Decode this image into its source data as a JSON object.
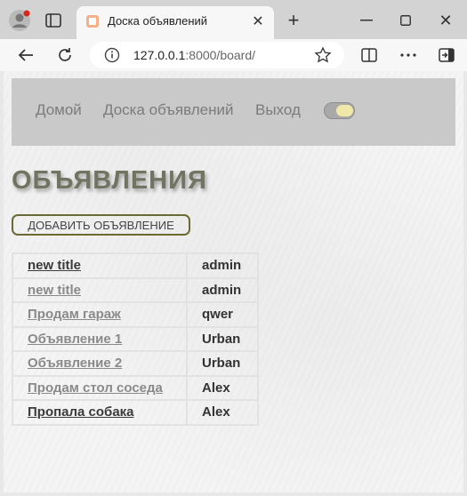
{
  "browser": {
    "tab_title": "Доска объявлений",
    "url_host": "127.0.0.1",
    "url_rest": ":8000/board/"
  },
  "navbar": {
    "home": "Домой",
    "board": "Доска объявлений",
    "exit": "Выход"
  },
  "page": {
    "title": "ОБЪЯВЛЕНИЯ",
    "add_button": "ДОБАВИТЬ ОБЪЯВЛЕНИЕ"
  },
  "ads": [
    {
      "title": "new title",
      "author": "admin"
    },
    {
      "title": "new title",
      "author": "admin"
    },
    {
      "title": "Продам гараж",
      "author": "qwer"
    },
    {
      "title": "Объявление 1",
      "author": "Urban"
    },
    {
      "title": "Объявление 2",
      "author": "Urban"
    },
    {
      "title": "Продам стол соседа",
      "author": "Alex"
    },
    {
      "title": "Пропала собака",
      "author": "Alex"
    }
  ],
  "colors": {
    "title": "#707460",
    "button_border": "#6b6a35",
    "navbar_bg": "#c9c9c9"
  },
  "icons": [
    "profile-icon",
    "tab-actions-icon",
    "favicon-icon",
    "close-tab-icon",
    "new-tab-icon",
    "minimize-icon",
    "maximize-icon",
    "close-window-icon",
    "back-icon",
    "reload-icon",
    "site-info-icon",
    "favorite-star-icon",
    "split-screen-icon",
    "more-menu-icon",
    "sidebar-icon",
    "theme-toggle"
  ]
}
